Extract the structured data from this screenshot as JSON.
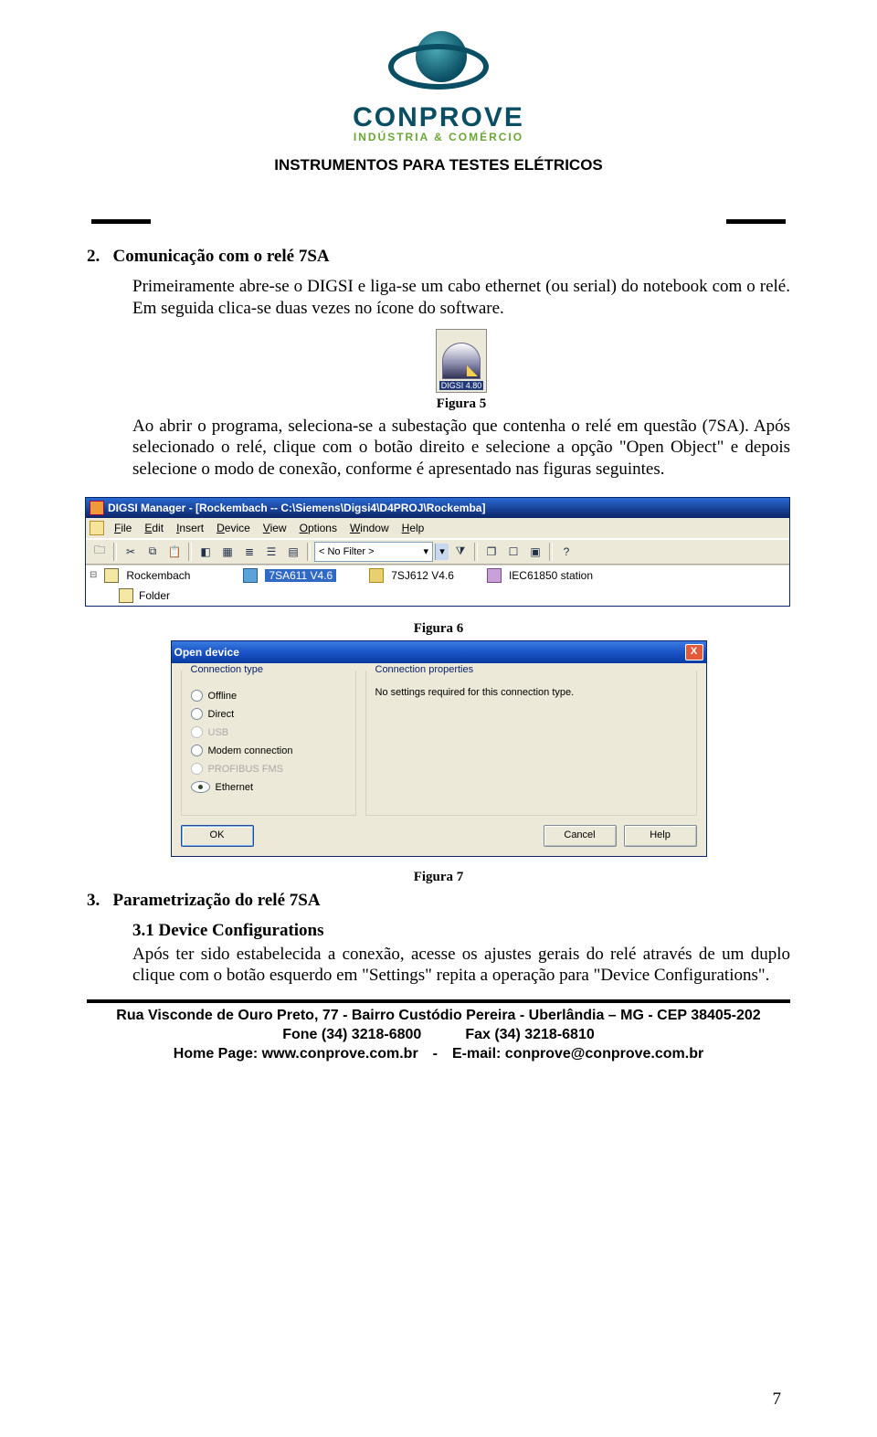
{
  "header": {
    "brand": "CONPROVE",
    "subline": "INDÚSTRIA & COMÉRCIO",
    "tagline": "INSTRUMENTOS PARA TESTES ELÉTRICOS"
  },
  "section2": {
    "number": "2.",
    "title": "Comunicação com o relé 7SA",
    "para1": "Primeiramente abre-se o DIGSI e liga-se um cabo ethernet (ou serial) do notebook com o relé. Em seguida clica-se duas vezes no ícone do software."
  },
  "digsi_icon_label": "DIGSI 4.80",
  "caption5": "Figura 5",
  "para2": "Ao abrir o programa, seleciona-se a subestação que contenha o relé em questão (7SA). Após selecionado o relé, clique com o botão direito e selecione a opção \"Open Object\" e depois selecione o modo de conexão, conforme é apresentado nas figuras seguintes.",
  "manager": {
    "title": "DIGSI Manager - [Rockembach -- C:\\Siemens\\Digsi4\\D4PROJ\\Rockemba]",
    "menus": [
      "File",
      "Edit",
      "Insert",
      "Device",
      "View",
      "Options",
      "Window",
      "Help"
    ],
    "filter": "< No Filter >",
    "tree_root": "Rockembach",
    "tree_folder": "Folder",
    "devices": {
      "sel": "7SA611 V4.6",
      "d2": "7SJ612 V4.6",
      "d3": "IEC61850 station"
    }
  },
  "caption6": "Figura 6",
  "dialog": {
    "title": "Open device",
    "group_conn": "Connection type",
    "group_props": "Connection properties",
    "props_text": "No settings required for this connection type.",
    "radios": {
      "offline": "Offline",
      "direct": "Direct",
      "usb": "USB",
      "modem": "Modem connection",
      "profibus": "PROFIBUS FMS",
      "ethernet": "Ethernet"
    },
    "buttons": {
      "ok": "OK",
      "cancel": "Cancel",
      "help": "Help"
    }
  },
  "caption7": "Figura 7",
  "section3": {
    "number": "3.",
    "title": "Parametrização do relé 7SA",
    "sub": "3.1 Device Configurations",
    "para": "Após ter sido estabelecida a conexão, acesse os ajustes gerais do relé através de um duplo clique com o botão esquerdo em \"Settings\" repita a operação para \"Device Configurations\"."
  },
  "footer": {
    "l1": "Rua Visconde de Ouro Preto, 77 - Bairro Custódio Pereira - Uberlândia – MG - CEP 38405-202",
    "l2": "Fone (34) 3218-6800   Fax (34) 3218-6810",
    "l3": "Home Page: www.conprove.com.br - E-mail: conprove@conprove.com.br"
  },
  "page_number": "7"
}
